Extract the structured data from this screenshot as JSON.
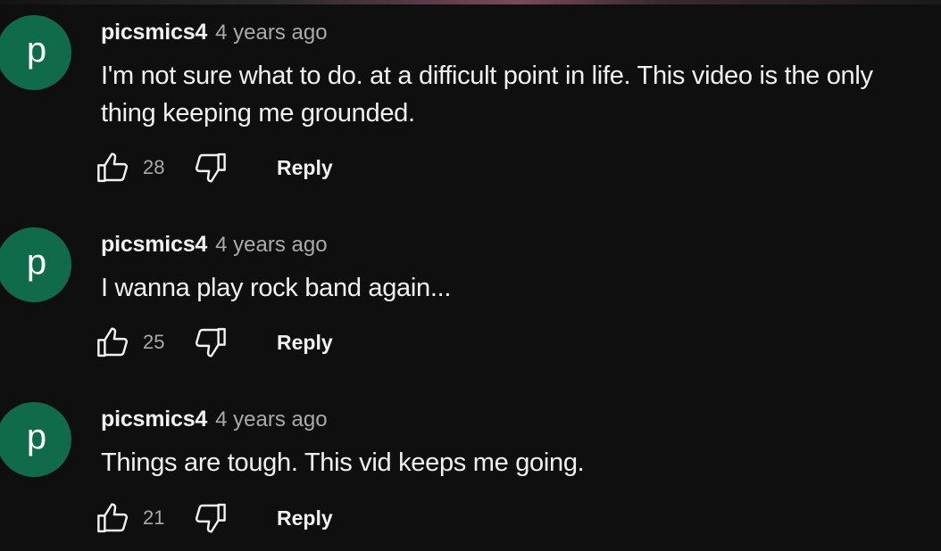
{
  "comments": [
    {
      "avatar_letter": "p",
      "author": "picsmics4",
      "time": "4 years ago",
      "text_lines": [
        "I'm not sure what to do.  at a difficult point in life.  This video is the only",
        "thing keeping me grounded."
      ],
      "likes": "28",
      "reply_label": "Reply"
    },
    {
      "avatar_letter": "p",
      "author": "picsmics4",
      "time": "4 years ago",
      "text_lines": [
        "I wanna play rock band again..."
      ],
      "likes": "25",
      "reply_label": "Reply"
    },
    {
      "avatar_letter": "p",
      "author": "picsmics4",
      "time": "4 years ago",
      "text_lines": [
        "Things are tough. This vid keeps me going."
      ],
      "likes": "21",
      "reply_label": "Reply"
    }
  ],
  "icons": {
    "like": "thumbs-up-icon",
    "dislike": "thumbs-down-icon"
  },
  "colors": {
    "background": "#0f0f0f",
    "avatar": "#0f6b4a",
    "primary_text": "#f1f1f1",
    "secondary_text": "#aaaaaa"
  }
}
